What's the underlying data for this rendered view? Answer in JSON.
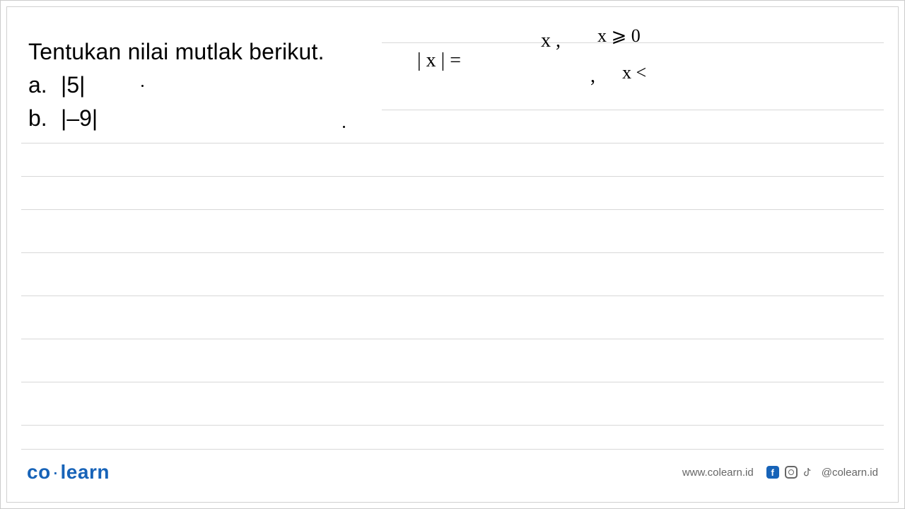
{
  "question": {
    "title": "Tentukan nilai mutlak berikut.",
    "items": [
      {
        "letter": "a.",
        "expr": "|5|"
      },
      {
        "letter": "b.",
        "expr": "|–9|"
      }
    ]
  },
  "handwriting": {
    "abs_expr": "| x |  =",
    "case1_val": "x  ,",
    "case2_comma": ",",
    "case1_cond": "x ⩾ 0",
    "case2_cond": "x <"
  },
  "footer": {
    "logo_part1": "co",
    "logo_part2": "learn",
    "url": "www.colearn.id",
    "handle": "@colearn.id"
  }
}
